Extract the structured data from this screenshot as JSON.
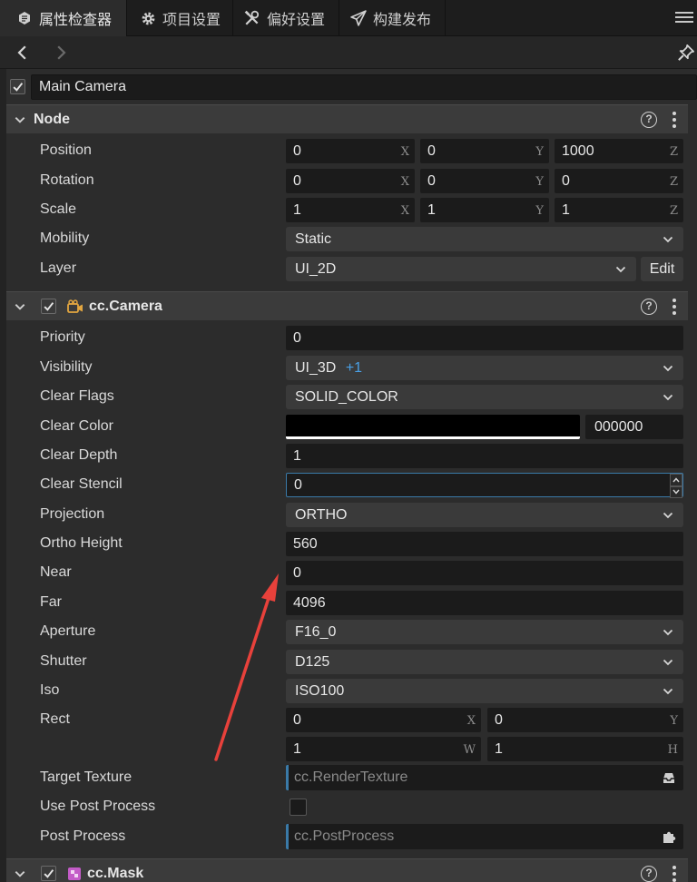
{
  "tabs": [
    {
      "label": "属性检查器",
      "icon": "inspector-icon"
    },
    {
      "label": "项目设置",
      "icon": "gear-icon"
    },
    {
      "label": "偏好设置",
      "icon": "tools-icon"
    },
    {
      "label": "构建发布",
      "icon": "send-icon"
    }
  ],
  "node": {
    "name": "Main Camera",
    "enabled": true
  },
  "node_section": {
    "title": "Node",
    "position": {
      "label": "Position",
      "x": "0",
      "y": "0",
      "z": "1000"
    },
    "rotation": {
      "label": "Rotation",
      "x": "0",
      "y": "0",
      "z": "0"
    },
    "scale": {
      "label": "Scale",
      "x": "1",
      "y": "1",
      "z": "1"
    },
    "mobility": {
      "label": "Mobility",
      "value": "Static"
    },
    "layer": {
      "label": "Layer",
      "value": "UI_2D",
      "edit": "Edit"
    }
  },
  "axes": {
    "x": "X",
    "y": "Y",
    "z": "Z",
    "w": "W",
    "h": "H"
  },
  "camera_section": {
    "title": "cc.Camera",
    "priority": {
      "label": "Priority",
      "value": "0"
    },
    "visibility": {
      "label": "Visibility",
      "value": "UI_3D",
      "extra": "+1"
    },
    "clear_flags": {
      "label": "Clear Flags",
      "value": "SOLID_COLOR"
    },
    "clear_color": {
      "label": "Clear Color",
      "hex": "000000",
      "swatch": "#000000"
    },
    "clear_depth": {
      "label": "Clear Depth",
      "value": "1"
    },
    "clear_stencil": {
      "label": "Clear Stencil",
      "value": "0"
    },
    "projection": {
      "label": "Projection",
      "value": "ORTHO"
    },
    "ortho_height": {
      "label": "Ortho Height",
      "value": "560"
    },
    "near": {
      "label": "Near",
      "value": "0"
    },
    "far": {
      "label": "Far",
      "value": "4096"
    },
    "aperture": {
      "label": "Aperture",
      "value": "F16_0"
    },
    "shutter": {
      "label": "Shutter",
      "value": "D125"
    },
    "iso": {
      "label": "Iso",
      "value": "ISO100"
    },
    "rect": {
      "label": "Rect",
      "x": "0",
      "y": "0",
      "w": "1",
      "h": "1"
    },
    "target_texture": {
      "label": "Target Texture",
      "placeholder": "cc.RenderTexture"
    },
    "use_post_process": {
      "label": "Use Post Process",
      "checked": false
    },
    "post_process": {
      "label": "Post Process",
      "placeholder": "cc.PostProcess"
    }
  },
  "mask_section": {
    "title": "cc.Mask"
  },
  "colors": {
    "accent": "#4aa0e6",
    "arrow": "#e8413b",
    "focus": "#3a7aa8"
  }
}
